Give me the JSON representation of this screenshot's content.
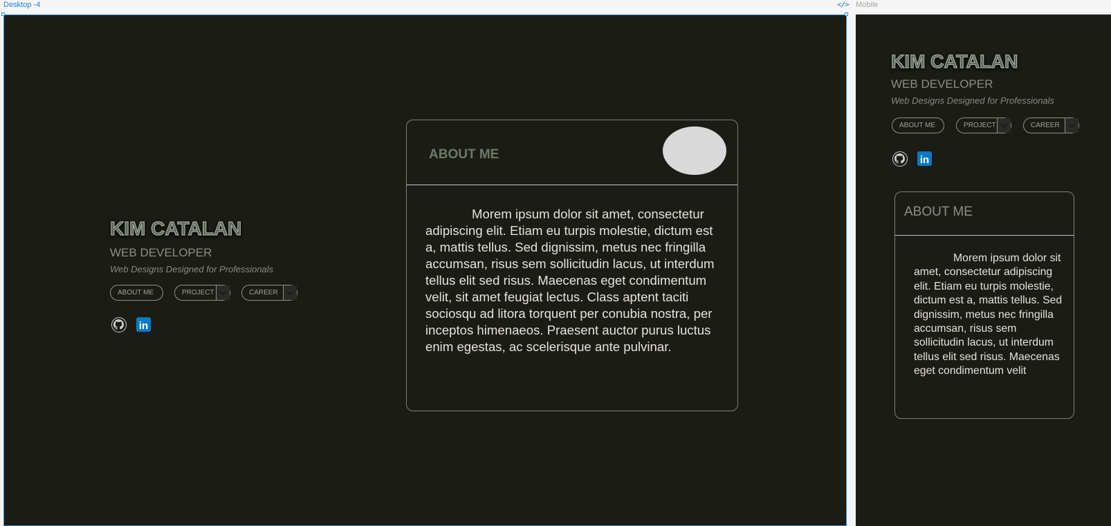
{
  "frames": {
    "desktop_label": "Desktop -4",
    "mobile_label": "Mobile",
    "code_icon": "</>"
  },
  "hero": {
    "name": "KIM CATALAN",
    "title": "WEB DEVELOPER",
    "tagline": "Web Designs Designed for Professionals"
  },
  "nav": {
    "about": "ABOUT ME",
    "project": "PROJECT",
    "career": "CAREER"
  },
  "social": {
    "github_icon": "github-icon",
    "linkedin_icon": "linkedin-icon",
    "linkedin_text": "in"
  },
  "about": {
    "title": "ABOUT ME",
    "desktop_body": "Morem ipsum dolor sit amet, consectetur adipiscing elit. Etiam eu turpis molestie, dictum est a, mattis tellus. Sed dignissim, metus nec fringilla accumsan, risus sem sollicitudin lacus, ut interdum tellus elit sed risus. Maecenas eget condimentum velit, sit amet feugiat lectus. Class aptent taciti sociosqu ad litora torquent per conubia nostra, per inceptos himenaeos. Praesent auctor purus luctus enim egestas, ac scelerisque ante pulvinar.",
    "mobile_body": "Morem ipsum dolor sit amet, consectetur adipiscing elit. Etiam eu turpis molestie, dictum est a, mattis tellus. Sed dignissim, metus nec fringilla accumsan, risus sem sollicitudin lacus, ut interdum tellus elit sed risus. Maecenas eget condimentum velit"
  },
  "colors": {
    "background": "#1b1c16",
    "accent_text": "#6b7a67",
    "body_text": "#e6e3d6",
    "selection": "#2d8ee0",
    "linkedin": "#0a7bc2"
  }
}
